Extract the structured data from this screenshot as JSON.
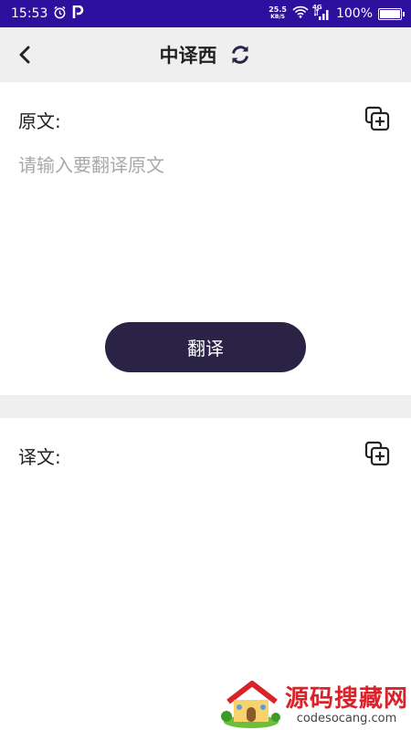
{
  "status_bar": {
    "time": "15:53",
    "speed_value": "25.5",
    "speed_unit": "KB/S",
    "network": "4G",
    "battery": "100%",
    "icons": [
      "alarm-icon",
      "p-app-icon",
      "wifi-icon",
      "signal-icon",
      "battery-icon"
    ]
  },
  "title_bar": {
    "title": "中译西",
    "back_icon": "chevron-left-icon",
    "swap_icon": "refresh-swap-icon"
  },
  "source": {
    "label": "原文:",
    "placeholder": "请输入要翻译原文",
    "value": "",
    "copy_icon": "copy-add-icon"
  },
  "translate_button": {
    "label": "翻译"
  },
  "result": {
    "label": "译文:",
    "value": "",
    "copy_icon": "copy-add-icon"
  },
  "watermark": {
    "brand": "源码搜藏网",
    "url": "codesocang.com"
  },
  "colors": {
    "status_bar": "#2f0f9e",
    "title_bar": "#efefef",
    "button": "#2b2345",
    "placeholder": "#a9a9a9",
    "watermark_red": "#d9222a"
  }
}
